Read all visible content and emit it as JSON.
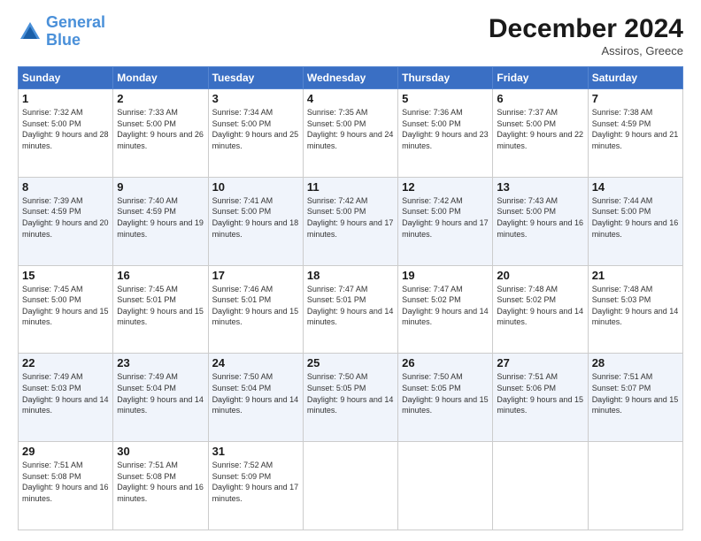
{
  "header": {
    "logo_general": "General",
    "logo_blue": "Blue",
    "month_title": "December 2024",
    "subtitle": "Assiros, Greece"
  },
  "days_of_week": [
    "Sunday",
    "Monday",
    "Tuesday",
    "Wednesday",
    "Thursday",
    "Friday",
    "Saturday"
  ],
  "weeks": [
    [
      {
        "day": "1",
        "sunrise": "Sunrise: 7:32 AM",
        "sunset": "Sunset: 5:00 PM",
        "daylight": "Daylight: 9 hours and 28 minutes."
      },
      {
        "day": "2",
        "sunrise": "Sunrise: 7:33 AM",
        "sunset": "Sunset: 5:00 PM",
        "daylight": "Daylight: 9 hours and 26 minutes."
      },
      {
        "day": "3",
        "sunrise": "Sunrise: 7:34 AM",
        "sunset": "Sunset: 5:00 PM",
        "daylight": "Daylight: 9 hours and 25 minutes."
      },
      {
        "day": "4",
        "sunrise": "Sunrise: 7:35 AM",
        "sunset": "Sunset: 5:00 PM",
        "daylight": "Daylight: 9 hours and 24 minutes."
      },
      {
        "day": "5",
        "sunrise": "Sunrise: 7:36 AM",
        "sunset": "Sunset: 5:00 PM",
        "daylight": "Daylight: 9 hours and 23 minutes."
      },
      {
        "day": "6",
        "sunrise": "Sunrise: 7:37 AM",
        "sunset": "Sunset: 5:00 PM",
        "daylight": "Daylight: 9 hours and 22 minutes."
      },
      {
        "day": "7",
        "sunrise": "Sunrise: 7:38 AM",
        "sunset": "Sunset: 4:59 PM",
        "daylight": "Daylight: 9 hours and 21 minutes."
      }
    ],
    [
      {
        "day": "8",
        "sunrise": "Sunrise: 7:39 AM",
        "sunset": "Sunset: 4:59 PM",
        "daylight": "Daylight: 9 hours and 20 minutes."
      },
      {
        "day": "9",
        "sunrise": "Sunrise: 7:40 AM",
        "sunset": "Sunset: 4:59 PM",
        "daylight": "Daylight: 9 hours and 19 minutes."
      },
      {
        "day": "10",
        "sunrise": "Sunrise: 7:41 AM",
        "sunset": "Sunset: 5:00 PM",
        "daylight": "Daylight: 9 hours and 18 minutes."
      },
      {
        "day": "11",
        "sunrise": "Sunrise: 7:42 AM",
        "sunset": "Sunset: 5:00 PM",
        "daylight": "Daylight: 9 hours and 17 minutes."
      },
      {
        "day": "12",
        "sunrise": "Sunrise: 7:42 AM",
        "sunset": "Sunset: 5:00 PM",
        "daylight": "Daylight: 9 hours and 17 minutes."
      },
      {
        "day": "13",
        "sunrise": "Sunrise: 7:43 AM",
        "sunset": "Sunset: 5:00 PM",
        "daylight": "Daylight: 9 hours and 16 minutes."
      },
      {
        "day": "14",
        "sunrise": "Sunrise: 7:44 AM",
        "sunset": "Sunset: 5:00 PM",
        "daylight": "Daylight: 9 hours and 16 minutes."
      }
    ],
    [
      {
        "day": "15",
        "sunrise": "Sunrise: 7:45 AM",
        "sunset": "Sunset: 5:00 PM",
        "daylight": "Daylight: 9 hours and 15 minutes."
      },
      {
        "day": "16",
        "sunrise": "Sunrise: 7:45 AM",
        "sunset": "Sunset: 5:01 PM",
        "daylight": "Daylight: 9 hours and 15 minutes."
      },
      {
        "day": "17",
        "sunrise": "Sunrise: 7:46 AM",
        "sunset": "Sunset: 5:01 PM",
        "daylight": "Daylight: 9 hours and 15 minutes."
      },
      {
        "day": "18",
        "sunrise": "Sunrise: 7:47 AM",
        "sunset": "Sunset: 5:01 PM",
        "daylight": "Daylight: 9 hours and 14 minutes."
      },
      {
        "day": "19",
        "sunrise": "Sunrise: 7:47 AM",
        "sunset": "Sunset: 5:02 PM",
        "daylight": "Daylight: 9 hours and 14 minutes."
      },
      {
        "day": "20",
        "sunrise": "Sunrise: 7:48 AM",
        "sunset": "Sunset: 5:02 PM",
        "daylight": "Daylight: 9 hours and 14 minutes."
      },
      {
        "day": "21",
        "sunrise": "Sunrise: 7:48 AM",
        "sunset": "Sunset: 5:03 PM",
        "daylight": "Daylight: 9 hours and 14 minutes."
      }
    ],
    [
      {
        "day": "22",
        "sunrise": "Sunrise: 7:49 AM",
        "sunset": "Sunset: 5:03 PM",
        "daylight": "Daylight: 9 hours and 14 minutes."
      },
      {
        "day": "23",
        "sunrise": "Sunrise: 7:49 AM",
        "sunset": "Sunset: 5:04 PM",
        "daylight": "Daylight: 9 hours and 14 minutes."
      },
      {
        "day": "24",
        "sunrise": "Sunrise: 7:50 AM",
        "sunset": "Sunset: 5:04 PM",
        "daylight": "Daylight: 9 hours and 14 minutes."
      },
      {
        "day": "25",
        "sunrise": "Sunrise: 7:50 AM",
        "sunset": "Sunset: 5:05 PM",
        "daylight": "Daylight: 9 hours and 14 minutes."
      },
      {
        "day": "26",
        "sunrise": "Sunrise: 7:50 AM",
        "sunset": "Sunset: 5:05 PM",
        "daylight": "Daylight: 9 hours and 15 minutes."
      },
      {
        "day": "27",
        "sunrise": "Sunrise: 7:51 AM",
        "sunset": "Sunset: 5:06 PM",
        "daylight": "Daylight: 9 hours and 15 minutes."
      },
      {
        "day": "28",
        "sunrise": "Sunrise: 7:51 AM",
        "sunset": "Sunset: 5:07 PM",
        "daylight": "Daylight: 9 hours and 15 minutes."
      }
    ],
    [
      {
        "day": "29",
        "sunrise": "Sunrise: 7:51 AM",
        "sunset": "Sunset: 5:08 PM",
        "daylight": "Daylight: 9 hours and 16 minutes."
      },
      {
        "day": "30",
        "sunrise": "Sunrise: 7:51 AM",
        "sunset": "Sunset: 5:08 PM",
        "daylight": "Daylight: 9 hours and 16 minutes."
      },
      {
        "day": "31",
        "sunrise": "Sunrise: 7:52 AM",
        "sunset": "Sunset: 5:09 PM",
        "daylight": "Daylight: 9 hours and 17 minutes."
      },
      null,
      null,
      null,
      null
    ]
  ]
}
